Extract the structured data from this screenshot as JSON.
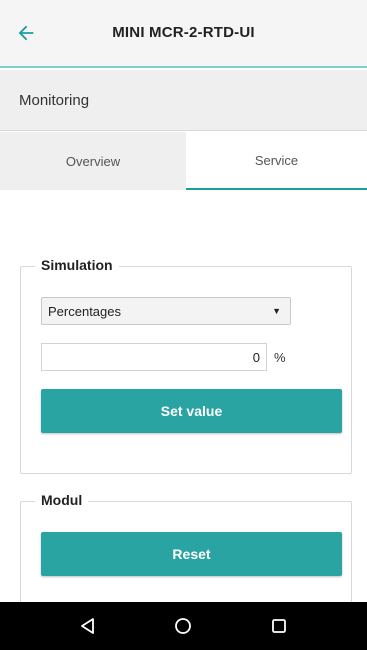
{
  "appbar": {
    "title": "MINI MCR-2-RTD-UI",
    "back_icon": "arrow-left-icon",
    "accent": "#1a9e9e"
  },
  "section": {
    "title": "Monitoring"
  },
  "tabs": [
    {
      "label": "Overview",
      "active": false
    },
    {
      "label": "Service",
      "active": true
    }
  ],
  "simulation": {
    "legend": "Simulation",
    "select_value": "Percentages",
    "input_value": "0",
    "unit": "%",
    "set_button": "Set value"
  },
  "modul": {
    "legend": "Modul",
    "reset_button": "Reset"
  },
  "navbar": {
    "back": "triangle-back-icon",
    "home": "circle-home-icon",
    "recents": "square-recents-icon"
  },
  "colors": {
    "button": "#2aa3a3",
    "accent_line": "#7ccfcf"
  }
}
